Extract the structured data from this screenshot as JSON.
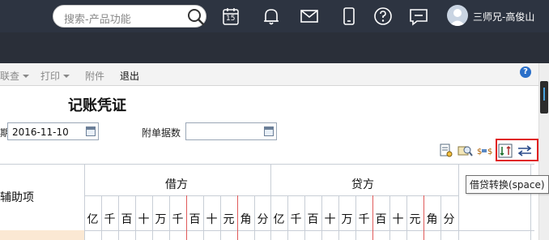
{
  "header": {
    "search_placeholder": "搜索-产品功能",
    "calendar_day": "15",
    "user_name": "三师兄-高俊山",
    "icons": [
      "search-icon",
      "calendar-icon",
      "bell-icon",
      "mail-icon",
      "mobile-icon",
      "help-circle-icon",
      "message-icon",
      "avatar-icon"
    ]
  },
  "toolbar": {
    "items": [
      {
        "label": "联查",
        "dropdown": true
      },
      {
        "label": "打印",
        "dropdown": true
      },
      {
        "label": "附件",
        "dropdown": false
      },
      {
        "label": "退出",
        "dropdown": false
      }
    ],
    "help_label": "?"
  },
  "voucher": {
    "title": "记账凭证",
    "date_label_fragment": "期",
    "date_value": "2016-11-10",
    "attachments_label": "附单据数",
    "attachments_value": ""
  },
  "actions": {
    "icons": [
      "preview-icon",
      "search-doc-icon",
      "currency-convert-icon",
      "debit-credit-swap-icon",
      "swap-arrows-icon"
    ],
    "highlight_color": "#e02020"
  },
  "tooltip": {
    "text": "借贷转换(space)"
  },
  "table": {
    "aux_header": "辅助项",
    "debit_header": "借方",
    "credit_header": "贷方",
    "debit_digits": [
      "亿",
      "千",
      "百",
      "十",
      "万",
      "千",
      "百",
      "十",
      "元",
      "角",
      "分"
    ],
    "credit_digits": [
      "亿",
      "千",
      "百",
      "十",
      "万",
      "千",
      "百",
      "十",
      "元",
      "角",
      "分"
    ]
  },
  "colors": {
    "header_bg": "#2d3441",
    "toolbar_bg": "#f3f3f3",
    "unit_separator": "#e05a5a",
    "row_highlight": "#fbe8d3"
  }
}
